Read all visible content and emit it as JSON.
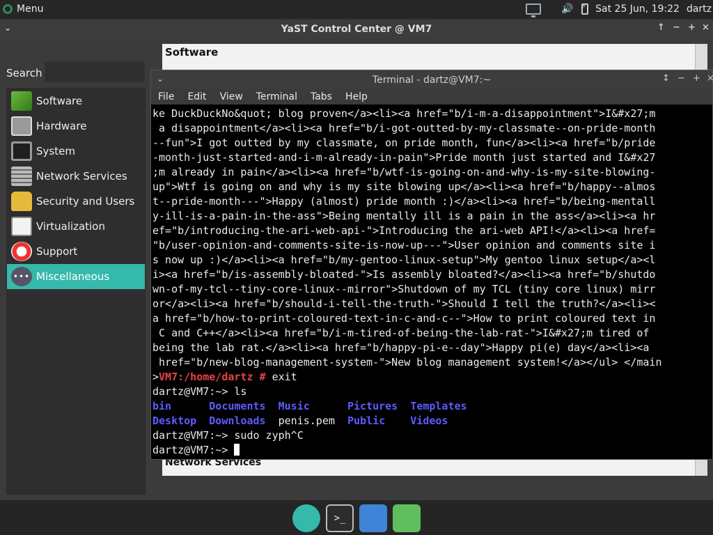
{
  "top_panel": {
    "menu_label": "Menu",
    "datetime": "Sat 25 Jun, 19:22",
    "user": "dartz",
    "tray_icons": [
      "network-icon",
      "volume-icon",
      "battery-icon"
    ]
  },
  "yast": {
    "title": "YaST Control Center @ VM7",
    "search_label": "Search",
    "search_value": "",
    "categories": [
      {
        "label": "Software",
        "icon": "software-icon"
      },
      {
        "label": "Hardware",
        "icon": "hardware-icon"
      },
      {
        "label": "System",
        "icon": "system-icon"
      },
      {
        "label": "Network Services",
        "icon": "network-services-icon"
      },
      {
        "label": "Security and Users",
        "icon": "lock-icon"
      },
      {
        "label": "Virtualization",
        "icon": "virtualization-icon"
      },
      {
        "label": "Support",
        "icon": "lifebuoy-icon"
      },
      {
        "label": "Miscellaneous",
        "icon": "misc-icon"
      }
    ],
    "selected_category": "Miscellaneous",
    "right_header": "Software",
    "network_services_header": "Network Services"
  },
  "terminal": {
    "title": "Terminal - dartz@VM7:~",
    "menu": [
      "File",
      "Edit",
      "View",
      "Terminal",
      "Tabs",
      "Help"
    ],
    "html_lines": [
      "ke DuckDuckNo&quot; blog proven</a><li><a href=\"b/i-m-a-disappointment\">I&#x27;m",
      " a disappointment</a><li><a href=\"b/i-got-outted-by-my-classmate--on-pride-month",
      "--fun\">I got outted by my classmate, on pride month, fun</a><li><a href=\"b/pride",
      "-month-just-started-and-i-m-already-in-pain\">Pride month just started and I&#x27",
      ";m already in pain</a><li><a href=\"b/wtf-is-going-on-and-why-is-my-site-blowing-",
      "up\">Wtf is going on and why is my site blowing up</a><li><a href=\"b/happy--almos",
      "t--pride-month---\">Happy (almost) pride month :)</a><li><a href=\"b/being-mentall",
      "y-ill-is-a-pain-in-the-ass\">Being mentally ill is a pain in the ass</a><li><a hr",
      "ef=\"b/introducing-the-ari-web-api-\">Introducing the ari-web API!</a><li><a href=",
      "\"b/user-opinion-and-comments-site-is-now-up---\">User opinion and comments site i",
      "s now up :)</a><li><a href=\"b/my-gentoo-linux-setup\">My gentoo linux setup</a><l",
      "i><a href=\"b/is-assembly-bloated-\">Is assembly bloated?</a><li><a href=\"b/shutdo",
      "wn-of-my-tcl--tiny-core-linux--mirror\">Shutdown of my TCL (tiny core linux) mirr",
      "or</a><li><a href=\"b/should-i-tell-the-truth-\">Should I tell the truth?</a><li><",
      "a href=\"b/how-to-print-coloured-text-in-c-and-c--\">How to print coloured text in",
      " C and C++</a><li><a href=\"b/i-m-tired-of-being-the-lab-rat-\">I&#x27;m tired of",
      "being the lab rat.</a><li><a href=\"b/happy-pi-e--day\">Happy pi(e) day</a><li><a",
      " href=\"b/new-blog-management-system-\">New blog management system!</a></ul> </main",
      ">"
    ],
    "root_prompt": "VM7:/home/dartz #",
    "root_cmd": " exit",
    "prompt1": "dartz@VM7:~> ls",
    "ls_row1": [
      {
        "name": "bin",
        "dir": true,
        "pad": "      "
      },
      {
        "name": "Documents",
        "dir": true,
        "pad": "  "
      },
      {
        "name": "Music",
        "dir": true,
        "pad": "      "
      },
      {
        "name": "Pictures",
        "dir": true,
        "pad": "  "
      },
      {
        "name": "Templates",
        "dir": true,
        "pad": ""
      }
    ],
    "ls_row2": [
      {
        "name": "Desktop",
        "dir": true,
        "pad": "  "
      },
      {
        "name": "Downloads",
        "dir": true,
        "pad": "  "
      },
      {
        "name": "penis.pem",
        "dir": false,
        "pad": "  "
      },
      {
        "name": "Public",
        "dir": true,
        "pad": "    "
      },
      {
        "name": "Videos",
        "dir": true,
        "pad": ""
      }
    ],
    "prompt2": "dartz@VM7:~> sudo zyph^C",
    "prompt3": "dartz@VM7:~> "
  },
  "dock": {
    "items": [
      "tux-icon",
      "terminal-icon",
      "downloads-folder-icon",
      "trash-icon"
    ],
    "terminal_glyph": ">_"
  }
}
